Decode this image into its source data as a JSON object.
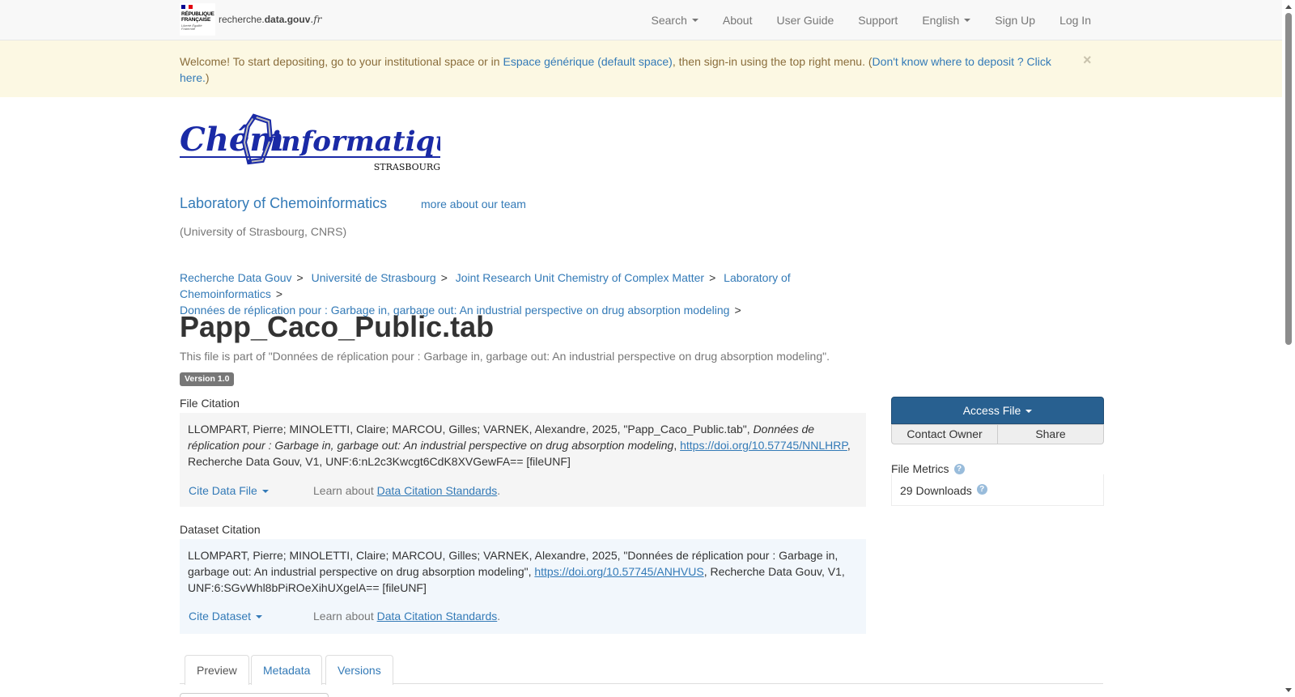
{
  "navbar": {
    "brand_gov_lines": [
      "RÉPUBLIQUE",
      "FRANÇAISE"
    ],
    "brand_motto": "Liberté Égalité Fraternité",
    "brand_site_prefix": "recherche.",
    "brand_site_bold": "data.gouv",
    "brand_site_suffix": ".fr",
    "items": [
      {
        "label": "Search",
        "dropdown": true
      },
      {
        "label": "About",
        "dropdown": false
      },
      {
        "label": "User Guide",
        "dropdown": false
      },
      {
        "label": "Support",
        "dropdown": false
      },
      {
        "label": "English",
        "dropdown": true
      },
      {
        "label": "Sign Up",
        "dropdown": false
      },
      {
        "label": "Log In",
        "dropdown": false
      }
    ]
  },
  "alert": {
    "text1": "Welcome! To start depositing, go to your institutional space or in ",
    "link1": "Espace générique (default space)",
    "text2": ", then sign-in using the top right menu. (",
    "link2": "Don't know where to deposit ? Click here.",
    "text3": ")",
    "close": "×"
  },
  "header": {
    "logo_word_left": "Chém",
    "logo_word_right": "informatique",
    "logo_sub": "STRASBOURG",
    "lab_name": "Laboratory of Chemoinformatics",
    "team_link": "more about our team",
    "affiliation": "(University of Strasbourg, CNRS)"
  },
  "breadcrumb": [
    "Recherche Data Gouv",
    "Université de Strasbourg",
    "Joint Research Unit Chemistry of Complex Matter",
    "Laboratory of Chemoinformatics",
    "Données de réplication pour : Garbage in, garbage out: An industrial perspective on drug absorption modeling"
  ],
  "breadcrumb_separator": ">",
  "file": {
    "title": "Papp_Caco_Public.tab",
    "part_of": "This file is part of \"Données de réplication pour : Garbage in, garbage out: An industrial perspective on drug absorption modeling\".",
    "version": "Version 1.0"
  },
  "file_citation": {
    "label": "File Citation",
    "text1": "LLOMPART, Pierre; MINOLETTI, Claire; MARCOU, Gilles; VARNEK, Alexandre, 2025, \"Papp_Caco_Public.tab\", ",
    "italic": "Données de réplication pour : Garbage in, garbage out: An industrial perspective on drug absorption modeling",
    "text2": ", ",
    "doi": "https://doi.org/10.57745/NNLHRP",
    "text3": ", Recherche Data Gouv, V1, UNF:6:nL2c3Kwcgt6CdK8XVGewFA== [fileUNF]",
    "cite_button": "Cite Data File",
    "learn_prefix": "Learn about ",
    "learn_link": "Data Citation Standards",
    "learn_suffix": "."
  },
  "dataset_citation": {
    "label": "Dataset Citation",
    "text1": "LLOMPART, Pierre; MINOLETTI, Claire; MARCOU, Gilles; VARNEK, Alexandre, 2025, \"Données de réplication pour : Garbage in, garbage out: An industrial perspective on drug absorption modeling\", ",
    "doi": "https://doi.org/10.57745/ANHVUS",
    "text2": ", Recherche Data Gouv, V1, UNF:6:SGvWhl8bPiROeXihUXgelA== [fileUNF]",
    "cite_button": "Cite Dataset",
    "learn_prefix": "Learn about ",
    "learn_link": "Data Citation Standards",
    "learn_suffix": "."
  },
  "actions": {
    "access_file": "Access File",
    "contact_owner": "Contact Owner",
    "share": "Share"
  },
  "metrics": {
    "label": "File Metrics",
    "downloads": "29 Downloads",
    "help": "?"
  },
  "tabs": [
    {
      "label": "Preview",
      "active": true
    },
    {
      "label": "Metadata",
      "active": false
    },
    {
      "label": "Versions",
      "active": false
    }
  ],
  "colors": {
    "primary": "#337ab7",
    "primary_button": "#286090",
    "alert_bg": "#fcf8e3",
    "alert_text": "#8a6d3b",
    "logo_blue": "#1a2aa6"
  }
}
